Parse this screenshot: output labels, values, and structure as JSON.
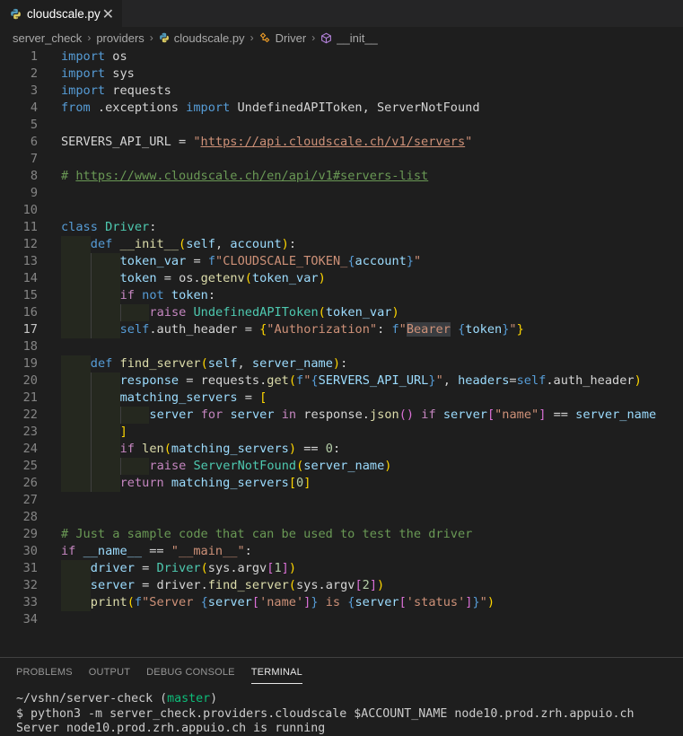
{
  "tab": {
    "label": "cloudscale.py",
    "close": "✕"
  },
  "breadcrumb": {
    "items": [
      "server_check",
      "providers",
      "cloudscale.py",
      "Driver",
      "__init__"
    ]
  },
  "editor": {
    "current_line": 17,
    "line_numbers": [
      "1",
      "2",
      "3",
      "4",
      "5",
      "6",
      "7",
      "8",
      "9",
      "10",
      "11",
      "12",
      "13",
      "14",
      "15",
      "16",
      "17",
      "18",
      "19",
      "20",
      "21",
      "22",
      "23",
      "24",
      "25",
      "26",
      "27",
      "28",
      "29",
      "30",
      "31",
      "32",
      "33",
      "34"
    ],
    "lines": [
      [
        [
          "kw",
          "import"
        ],
        [
          "",
          "  os"
        ]
      ],
      [
        [
          "kw",
          "import"
        ],
        [
          "",
          "  sys"
        ]
      ],
      [
        [
          "kw",
          "import"
        ],
        [
          "",
          "  requests"
        ]
      ],
      [
        [
          "kw",
          "from"
        ],
        [
          "",
          " .exceptions "
        ],
        [
          "kw",
          "import"
        ],
        [
          "",
          " UndefinedAPIToken, ServerNotFound"
        ]
      ],
      [],
      [
        [
          "",
          "SERVERS_API_URL = "
        ],
        [
          "str",
          "\""
        ],
        [
          "str lnk",
          "https://api.cloudscale.ch/v1/servers"
        ],
        [
          "str",
          "\""
        ]
      ],
      [],
      [
        [
          "cm",
          "# "
        ],
        [
          "cm lnk",
          "https://www.cloudscale.ch/en/api/v1#servers-list"
        ]
      ],
      [],
      [],
      [
        [
          "kw",
          "class"
        ],
        [
          "",
          " "
        ],
        [
          "cls",
          "Driver"
        ],
        [
          "",
          ":"
        ]
      ],
      [
        [
          "",
          ""
        ],
        [
          "kw",
          "def"
        ],
        [
          "",
          " "
        ],
        [
          "fn",
          "__init__"
        ],
        [
          "brk1",
          "("
        ],
        [
          "var",
          "self"
        ],
        [
          "",
          ", "
        ],
        [
          "var",
          "account"
        ],
        [
          "brk1",
          ")"
        ],
        [
          "",
          ":"
        ]
      ],
      [
        [
          "var",
          "token_var"
        ],
        [
          "",
          " = "
        ],
        [
          "kw",
          "f"
        ],
        [
          "str",
          "\"CLOUDSCALE_TOKEN_"
        ],
        [
          "kw",
          "{"
        ],
        [
          "var",
          "account"
        ],
        [
          "kw",
          "}"
        ],
        [
          "str",
          "\""
        ]
      ],
      [
        [
          "var",
          "token"
        ],
        [
          "",
          " = os."
        ],
        [
          "fn",
          "getenv"
        ],
        [
          "brk1",
          "("
        ],
        [
          "var",
          "token_var"
        ],
        [
          "brk1",
          ")"
        ]
      ],
      [
        [
          "ctrl",
          "if"
        ],
        [
          "",
          " "
        ],
        [
          "kw",
          "not"
        ],
        [
          "",
          " "
        ],
        [
          "var",
          "token"
        ],
        [
          "",
          ":"
        ]
      ],
      [
        [
          "ctrl",
          "raise"
        ],
        [
          "",
          " "
        ],
        [
          "cls",
          "UndefinedAPIToken"
        ],
        [
          "brk1",
          "("
        ],
        [
          "var",
          "token_var"
        ],
        [
          "brk1",
          ")"
        ]
      ],
      [
        [
          "kw",
          "self"
        ],
        [
          "",
          ".auth_header = "
        ],
        [
          "brk1",
          "{"
        ],
        [
          "str",
          "\"Authorization\""
        ],
        [
          "",
          ": "
        ],
        [
          "kw",
          "f"
        ],
        [
          "str",
          "\""
        ],
        [
          "str selword",
          "Bearer"
        ],
        [
          "str",
          " "
        ],
        [
          "kw",
          "{"
        ],
        [
          "var",
          "token"
        ],
        [
          "kw",
          "}"
        ],
        [
          "str",
          "\""
        ],
        [
          "brk1",
          "}"
        ]
      ],
      [],
      [
        [
          "kw",
          "def"
        ],
        [
          "",
          " "
        ],
        [
          "fn",
          "find_server"
        ],
        [
          "brk1",
          "("
        ],
        [
          "var",
          "self"
        ],
        [
          "",
          ", "
        ],
        [
          "var",
          "server_name"
        ],
        [
          "brk1",
          ")"
        ],
        [
          "",
          ":"
        ]
      ],
      [
        [
          "var",
          "response"
        ],
        [
          "",
          " = requests."
        ],
        [
          "fn",
          "get"
        ],
        [
          "brk1",
          "("
        ],
        [
          "kw",
          "f"
        ],
        [
          "str",
          "\""
        ],
        [
          "kw",
          "{"
        ],
        [
          "var",
          "SERVERS_API_URL"
        ],
        [
          "kw",
          "}"
        ],
        [
          "str",
          "\""
        ],
        [
          "",
          ", "
        ],
        [
          "var",
          "headers"
        ],
        [
          "",
          "="
        ],
        [
          "kw",
          "self"
        ],
        [
          "",
          ".auth_header"
        ],
        [
          "brk1",
          ")"
        ]
      ],
      [
        [
          "var",
          "matching_servers"
        ],
        [
          "",
          " = "
        ],
        [
          "brk1",
          "["
        ]
      ],
      [
        [
          "var",
          "server"
        ],
        [
          "",
          " "
        ],
        [
          "ctrl",
          "for"
        ],
        [
          "",
          " "
        ],
        [
          "var",
          "server"
        ],
        [
          "",
          " "
        ],
        [
          "ctrl",
          "in"
        ],
        [
          "",
          " response."
        ],
        [
          "fn",
          "json"
        ],
        [
          "brk2",
          "()"
        ],
        [
          "",
          " "
        ],
        [
          "ctrl",
          "if"
        ],
        [
          "",
          " "
        ],
        [
          "var",
          "server"
        ],
        [
          "brk2",
          "["
        ],
        [
          "str",
          "\"name\""
        ],
        [
          "brk2",
          "]"
        ],
        [
          "",
          " == "
        ],
        [
          "var",
          "server_name"
        ]
      ],
      [
        [
          "brk1",
          "]"
        ]
      ],
      [
        [
          "ctrl",
          "if"
        ],
        [
          "",
          " "
        ],
        [
          "fn",
          "len"
        ],
        [
          "brk1",
          "("
        ],
        [
          "var",
          "matching_servers"
        ],
        [
          "brk1",
          ")"
        ],
        [
          "",
          " == "
        ],
        [
          "num",
          "0"
        ],
        [
          "",
          ":"
        ]
      ],
      [
        [
          "ctrl",
          "raise"
        ],
        [
          "",
          " "
        ],
        [
          "cls",
          "ServerNotFound"
        ],
        [
          "brk1",
          "("
        ],
        [
          "var",
          "server_name"
        ],
        [
          "brk1",
          ")"
        ]
      ],
      [
        [
          "ctrl",
          "return"
        ],
        [
          "",
          " "
        ],
        [
          "var",
          "matching_servers"
        ],
        [
          "brk1",
          "["
        ],
        [
          "num",
          "0"
        ],
        [
          "brk1",
          "]"
        ]
      ],
      [],
      [],
      [
        [
          "cm",
          "# Just a sample code that can be used to test the driver"
        ]
      ],
      [
        [
          "ctrl",
          "if"
        ],
        [
          "",
          " "
        ],
        [
          "var",
          "__name__"
        ],
        [
          "",
          " == "
        ],
        [
          "str",
          "\"__main__\""
        ],
        [
          "",
          ":"
        ]
      ],
      [
        [
          "var",
          "driver"
        ],
        [
          "",
          " = "
        ],
        [
          "cls",
          "Driver"
        ],
        [
          "brk1",
          "("
        ],
        [
          "",
          "sys.argv"
        ],
        [
          "brk2",
          "["
        ],
        [
          "num",
          "1"
        ],
        [
          "brk2",
          "]"
        ],
        [
          "brk1",
          ")"
        ]
      ],
      [
        [
          "var",
          "server"
        ],
        [
          "",
          " = driver."
        ],
        [
          "fn",
          "find_server"
        ],
        [
          "brk1",
          "("
        ],
        [
          "",
          "sys.argv"
        ],
        [
          "brk2",
          "["
        ],
        [
          "num",
          "2"
        ],
        [
          "brk2",
          "]"
        ],
        [
          "brk1",
          ")"
        ]
      ],
      [
        [
          "fn",
          "print"
        ],
        [
          "brk1",
          "("
        ],
        [
          "kw",
          "f"
        ],
        [
          "str",
          "\"Server "
        ],
        [
          "kw",
          "{"
        ],
        [
          "var",
          "server"
        ],
        [
          "brk2",
          "["
        ],
        [
          "str",
          "'name'"
        ],
        [
          "brk2",
          "]"
        ],
        [
          "kw",
          "}"
        ],
        [
          "str",
          " is "
        ],
        [
          "kw",
          "{"
        ],
        [
          "var",
          "server"
        ],
        [
          "brk2",
          "["
        ],
        [
          "str",
          "'status'"
        ],
        [
          "brk2",
          "]"
        ],
        [
          "kw",
          "}"
        ],
        [
          "str",
          "\""
        ],
        [
          "brk1",
          ")"
        ]
      ],
      []
    ]
  },
  "panel": {
    "tabs": [
      "PROBLEMS",
      "OUTPUT",
      "DEBUG CONSOLE",
      "TERMINAL"
    ],
    "active_tab": "TERMINAL",
    "terminal": {
      "prompt_path": "~/vshn/server-check ",
      "prompt_branch_open": "(",
      "prompt_branch": "master",
      "prompt_branch_close": ")",
      "command": "$ python3 -m server_check.providers.cloudscale $ACCOUNT_NAME node10.prod.zrh.appuio.ch",
      "output": "Server node10.prod.zrh.appuio.ch is running"
    }
  },
  "colors": {
    "editor_bg": "#1e1e1e",
    "keyword": "#569cd6",
    "control": "#c586c0",
    "function": "#dcdcaa",
    "class": "#4ec9b0",
    "variable": "#9cdcfe",
    "string": "#ce9178",
    "number": "#b5cea8",
    "comment": "#6a9955",
    "branch": "#0dbc79"
  }
}
